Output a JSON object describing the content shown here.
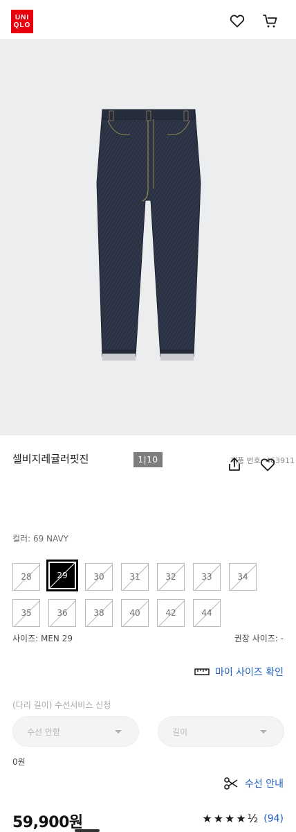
{
  "header": {
    "logo_line1": "UNI",
    "logo_line2": "QLO",
    "logo_color": "#e8000f",
    "icons": [
      "heart-icon",
      "cart-icon"
    ]
  },
  "gallery": {
    "pager": "1|10",
    "product_number": "제품 번호: 463911"
  },
  "product": {
    "title": "셀비지레귤러핏진",
    "color_label": "컬러: 69 NAVY",
    "sizes": [
      {
        "label": "28",
        "available": false,
        "selected": false
      },
      {
        "label": "29",
        "available": false,
        "selected": true
      },
      {
        "label": "30",
        "available": false,
        "selected": false
      },
      {
        "label": "31",
        "available": false,
        "selected": false
      },
      {
        "label": "32",
        "available": false,
        "selected": false
      },
      {
        "label": "33",
        "available": false,
        "selected": false
      },
      {
        "label": "34",
        "available": false,
        "selected": false
      },
      {
        "label": "35",
        "available": false,
        "selected": false
      },
      {
        "label": "36",
        "available": false,
        "selected": false
      },
      {
        "label": "38",
        "available": false,
        "selected": false
      },
      {
        "label": "40",
        "available": false,
        "selected": false
      },
      {
        "label": "42",
        "available": false,
        "selected": false
      },
      {
        "label": "44",
        "available": false,
        "selected": false
      }
    ],
    "size_label": "사이즈: MEN 29",
    "recommended_size": "권장 사이즈: -",
    "my_size_link": "마이 사이즈 확인",
    "alteration_label": "(다리 길이) 수선서비스 신청",
    "alteration_select": "수선 안함",
    "length_select": "길이",
    "alteration_price": "0원",
    "alteration_guide": "수선 안내",
    "price": "59,900원",
    "rating_stars": "★★★★½",
    "review_count": "(94)"
  },
  "colors": {
    "link": "#1f5fbf",
    "denim": "#2a3142"
  }
}
